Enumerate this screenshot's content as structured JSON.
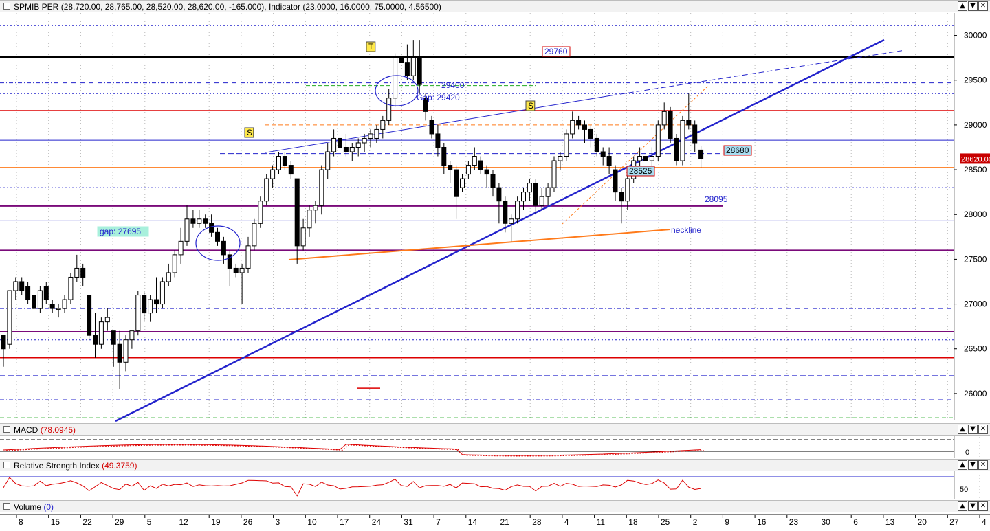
{
  "main_panel": {
    "symbol": "SPMIB PER",
    "ohlc": "(28,720.00, 28,765.00, 28,520.00, 28,620.00, -165.000)",
    "indicator_label": "Indicator",
    "indicator_values": "(23.0000, 16.0000, 75.0000, 4.56500)"
  },
  "macd_panel": {
    "label": "MACD",
    "value": "(78.0945)"
  },
  "rsi_panel": {
    "label": "Relative Strength Index",
    "value": "(49.3759)"
  },
  "volume_panel": {
    "label": "Volume",
    "value": "(0)"
  },
  "window_buttons": {
    "up": "▲",
    "down": "▼",
    "close": "✕"
  },
  "colors": {
    "bull": "#ffffff",
    "bear": "#000000",
    "trend": "#2323cc",
    "red_level": "#dd0000",
    "purple_level": "#7a0a7a",
    "orange": "#ff7a1a",
    "price_box": "#c80000"
  },
  "chart_data": {
    "type": "candlestick",
    "y_range": [
      25700,
      30250
    ],
    "y_ticks": [
      26000,
      26500,
      27000,
      27500,
      28000,
      28500,
      29000,
      29500,
      30000
    ],
    "x_tick_labels": [
      "8",
      "15",
      "22",
      "29",
      "5",
      "12",
      "19",
      "26",
      "3",
      "10",
      "17",
      "24",
      "31",
      "7",
      "14",
      "21",
      "28",
      "4",
      "11",
      "18",
      "25",
      "2",
      "9",
      "16",
      "23",
      "30",
      "6",
      "13",
      "20",
      "27",
      "4"
    ],
    "last_price": "28620.00",
    "candles": [
      [
        26650,
        26650,
        26300,
        26500
      ],
      [
        26550,
        27150,
        26500,
        27150
      ],
      [
        27150,
        27300,
        27050,
        27250
      ],
      [
        27250,
        27300,
        27100,
        27150
      ],
      [
        27200,
        27250,
        27000,
        27050
      ],
      [
        27100,
        27150,
        26850,
        26950
      ],
      [
        26950,
        27200,
        26900,
        27150
      ],
      [
        27200,
        27250,
        27000,
        27050
      ],
      [
        27000,
        27050,
        26900,
        26950
      ],
      [
        26950,
        27000,
        26850,
        26950
      ],
      [
        26950,
        27100,
        26900,
        27050
      ],
      [
        27050,
        27350,
        27000,
        27300
      ],
      [
        27300,
        27550,
        27250,
        27400
      ],
      [
        27400,
        27450,
        27200,
        27300
      ],
      [
        27100,
        27100,
        26600,
        26650
      ],
      [
        26650,
        26900,
        26400,
        26550
      ],
      [
        26550,
        26850,
        26500,
        26800
      ],
      [
        26800,
        26950,
        26700,
        26850
      ],
      [
        26700,
        26700,
        26300,
        26550
      ],
      [
        26550,
        26700,
        26050,
        26350
      ],
      [
        26350,
        26650,
        26250,
        26600
      ],
      [
        26600,
        26700,
        26500,
        26700
      ],
      [
        26700,
        27150,
        26650,
        27100
      ],
      [
        27100,
        27150,
        26800,
        26900
      ],
      [
        26900,
        27100,
        26800,
        27050
      ],
      [
        27050,
        27300,
        26900,
        27000
      ],
      [
        27000,
        27300,
        26950,
        27250
      ],
      [
        27250,
        27450,
        27200,
        27350
      ],
      [
        27350,
        27600,
        27300,
        27550
      ],
      [
        27550,
        27850,
        27450,
        27700
      ],
      [
        27700,
        28100,
        27650,
        27950
      ],
      [
        27950,
        28050,
        27850,
        27900
      ],
      [
        27900,
        28050,
        27850,
        27950
      ],
      [
        27950,
        28000,
        27850,
        27900
      ],
      [
        27900,
        28000,
        27750,
        27800
      ],
      [
        27800,
        27850,
        27650,
        27700
      ],
      [
        27700,
        27750,
        27450,
        27550
      ],
      [
        27550,
        27600,
        27200,
        27400
      ],
      [
        27400,
        27450,
        27300,
        27350
      ],
      [
        27350,
        27450,
        27000,
        27400
      ],
      [
        27400,
        27750,
        27350,
        27650
      ],
      [
        27650,
        27950,
        27600,
        27900
      ],
      [
        27900,
        28200,
        27850,
        28150
      ],
      [
        28150,
        28450,
        28100,
        28400
      ],
      [
        28400,
        28550,
        28300,
        28500
      ],
      [
        28500,
        28700,
        28450,
        28650
      ],
      [
        28650,
        28700,
        28500,
        28550
      ],
      [
        28550,
        28600,
        28400,
        28450
      ],
      [
        28400,
        28400,
        27450,
        27650
      ],
      [
        27650,
        27950,
        27600,
        27850
      ],
      [
        27850,
        28100,
        27750,
        28050
      ],
      [
        28050,
        28150,
        27900,
        28100
      ],
      [
        28100,
        28550,
        28000,
        28500
      ],
      [
        28500,
        28800,
        28400,
        28700
      ],
      [
        28700,
        28950,
        28650,
        28850
      ],
      [
        28850,
        28900,
        28700,
        28750
      ],
      [
        28750,
        28900,
        28650,
        28700
      ],
      [
        28700,
        28800,
        28600,
        28750
      ],
      [
        28750,
        28850,
        28650,
        28800
      ],
      [
        28800,
        28900,
        28700,
        28850
      ],
      [
        28850,
        28950,
        28750,
        28900
      ],
      [
        28850,
        29000,
        28800,
        28950
      ],
      [
        28950,
        29100,
        28850,
        29050
      ],
      [
        29050,
        29400,
        29000,
        29300
      ],
      [
        29300,
        29800,
        29200,
        29750
      ],
      [
        29750,
        29850,
        29600,
        29700
      ],
      [
        29700,
        29900,
        29500,
        29550
      ],
      [
        29550,
        29950,
        29500,
        29750
      ],
      [
        29750,
        29950,
        29350,
        29450
      ],
      [
        29300,
        29350,
        29050,
        29150
      ],
      [
        29050,
        29100,
        28850,
        28900
      ],
      [
        28900,
        29000,
        28650,
        28750
      ],
      [
        28750,
        28800,
        28450,
        28550
      ],
      [
        28550,
        28600,
        28350,
        28500
      ],
      [
        28500,
        28550,
        27950,
        28200
      ],
      [
        28300,
        28450,
        28250,
        28400
      ],
      [
        28450,
        28600,
        28400,
        28550
      ],
      [
        28550,
        28750,
        28500,
        28650
      ],
      [
        28600,
        28650,
        28450,
        28500
      ],
      [
        28500,
        28550,
        28300,
        28450
      ],
      [
        28450,
        28500,
        28200,
        28300
      ],
      [
        28300,
        28350,
        27900,
        28150
      ],
      [
        28150,
        28200,
        27800,
        27900
      ],
      [
        27900,
        28000,
        27700,
        27950
      ],
      [
        27950,
        28200,
        27900,
        28150
      ],
      [
        28150,
        28300,
        28050,
        28250
      ],
      [
        28250,
        28400,
        28150,
        28350
      ],
      [
        28350,
        28400,
        28000,
        28100
      ],
      [
        28100,
        28300,
        28050,
        28200
      ],
      [
        28200,
        28350,
        28100,
        28300
      ],
      [
        28300,
        28650,
        28250,
        28600
      ],
      [
        28600,
        28700,
        28500,
        28650
      ],
      [
        28650,
        28950,
        28600,
        28900
      ],
      [
        28900,
        29150,
        28850,
        29050
      ],
      [
        29050,
        29100,
        28950,
        29000
      ],
      [
        29000,
        29050,
        28800,
        28950
      ],
      [
        28950,
        29000,
        28750,
        28850
      ],
      [
        28850,
        28900,
        28650,
        28700
      ],
      [
        28700,
        28750,
        28550,
        28650
      ],
      [
        28650,
        28750,
        28450,
        28550
      ],
      [
        28500,
        28550,
        28150,
        28250
      ],
      [
        28250,
        28300,
        27900,
        28150
      ],
      [
        28150,
        28450,
        28050,
        28400
      ],
      [
        28400,
        28650,
        28350,
        28600
      ],
      [
        28600,
        28750,
        28500,
        28650
      ],
      [
        28650,
        28700,
        28550,
        28600
      ],
      [
        28600,
        28750,
        28500,
        28650
      ],
      [
        28650,
        29050,
        28600,
        29000
      ],
      [
        29000,
        29250,
        28950,
        29150
      ],
      [
        29150,
        29200,
        28800,
        28850
      ],
      [
        28850,
        28900,
        28550,
        28600
      ],
      [
        28600,
        29100,
        28550,
        29050
      ],
      [
        29050,
        29350,
        28950,
        29000
      ],
      [
        29000,
        29050,
        28700,
        28800
      ],
      [
        28720,
        28765,
        28520,
        28620
      ]
    ]
  },
  "annotations": {
    "level_29760": "29760",
    "level_29400": "29400",
    "gap_29420": "Gap: 29420",
    "level_28680": "28680",
    "level_28525": "28525",
    "level_28095": "28095",
    "gap_27695": "gap: 27695",
    "neckline": "neckline",
    "mark_t": "T",
    "mark_s_left": "S",
    "mark_s_right": "S"
  },
  "rsi_tick": "50",
  "macd_tick": "0"
}
